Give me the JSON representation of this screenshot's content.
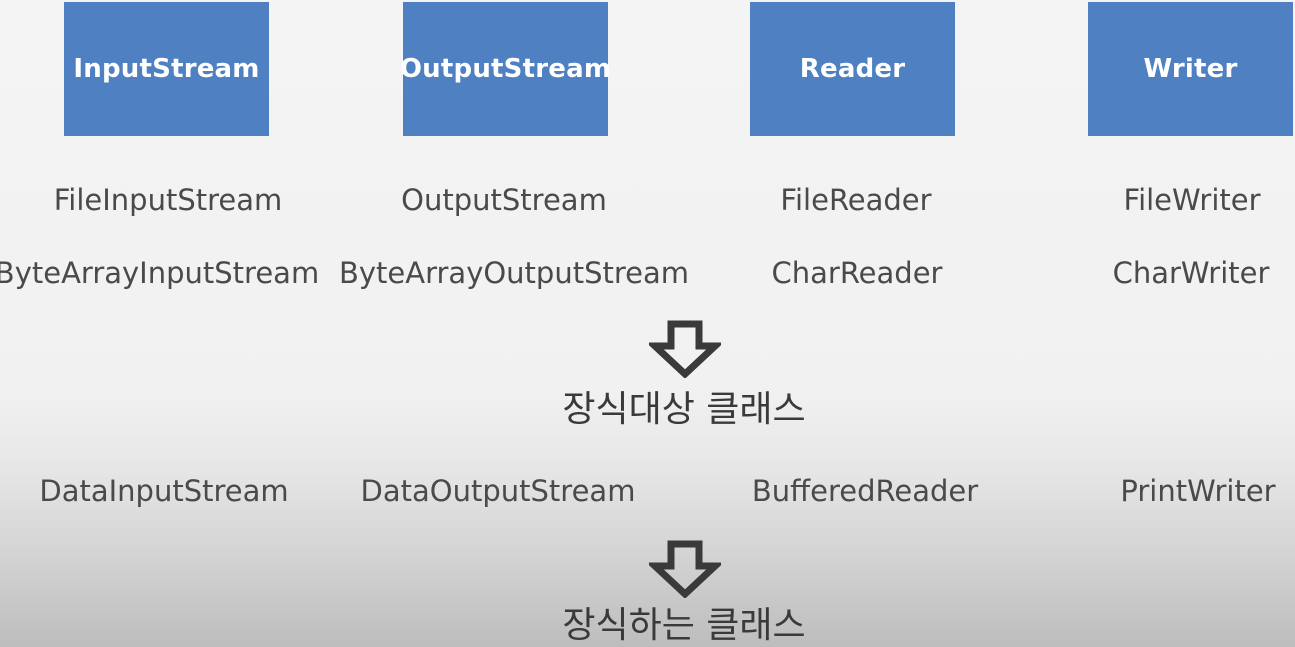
{
  "headers": {
    "input_stream": "InputStream",
    "output_stream": "OutputStream",
    "reader": "Reader",
    "writer": "Writer"
  },
  "base_classes": {
    "row1": [
      "FileInputStream",
      "OutputStream",
      "FileReader",
      "FileWriter"
    ],
    "row2": [
      "ByteArrayInputStream",
      "ByteArrayOutputStream",
      "CharReader",
      "CharWriter"
    ]
  },
  "decorated_caption": "장식대상 클래스",
  "decorator_classes": [
    "DataInputStream",
    "DataOutputStream",
    "BufferedReader",
    "PrintWriter"
  ],
  "decorator_caption": "장식하는 클래스",
  "colors": {
    "header_box": "#4f80c1",
    "header_text": "#ffffff",
    "label_text": "#4a4a4a"
  },
  "icons": [
    "down-arrow-icon",
    "down-arrow-icon"
  ]
}
